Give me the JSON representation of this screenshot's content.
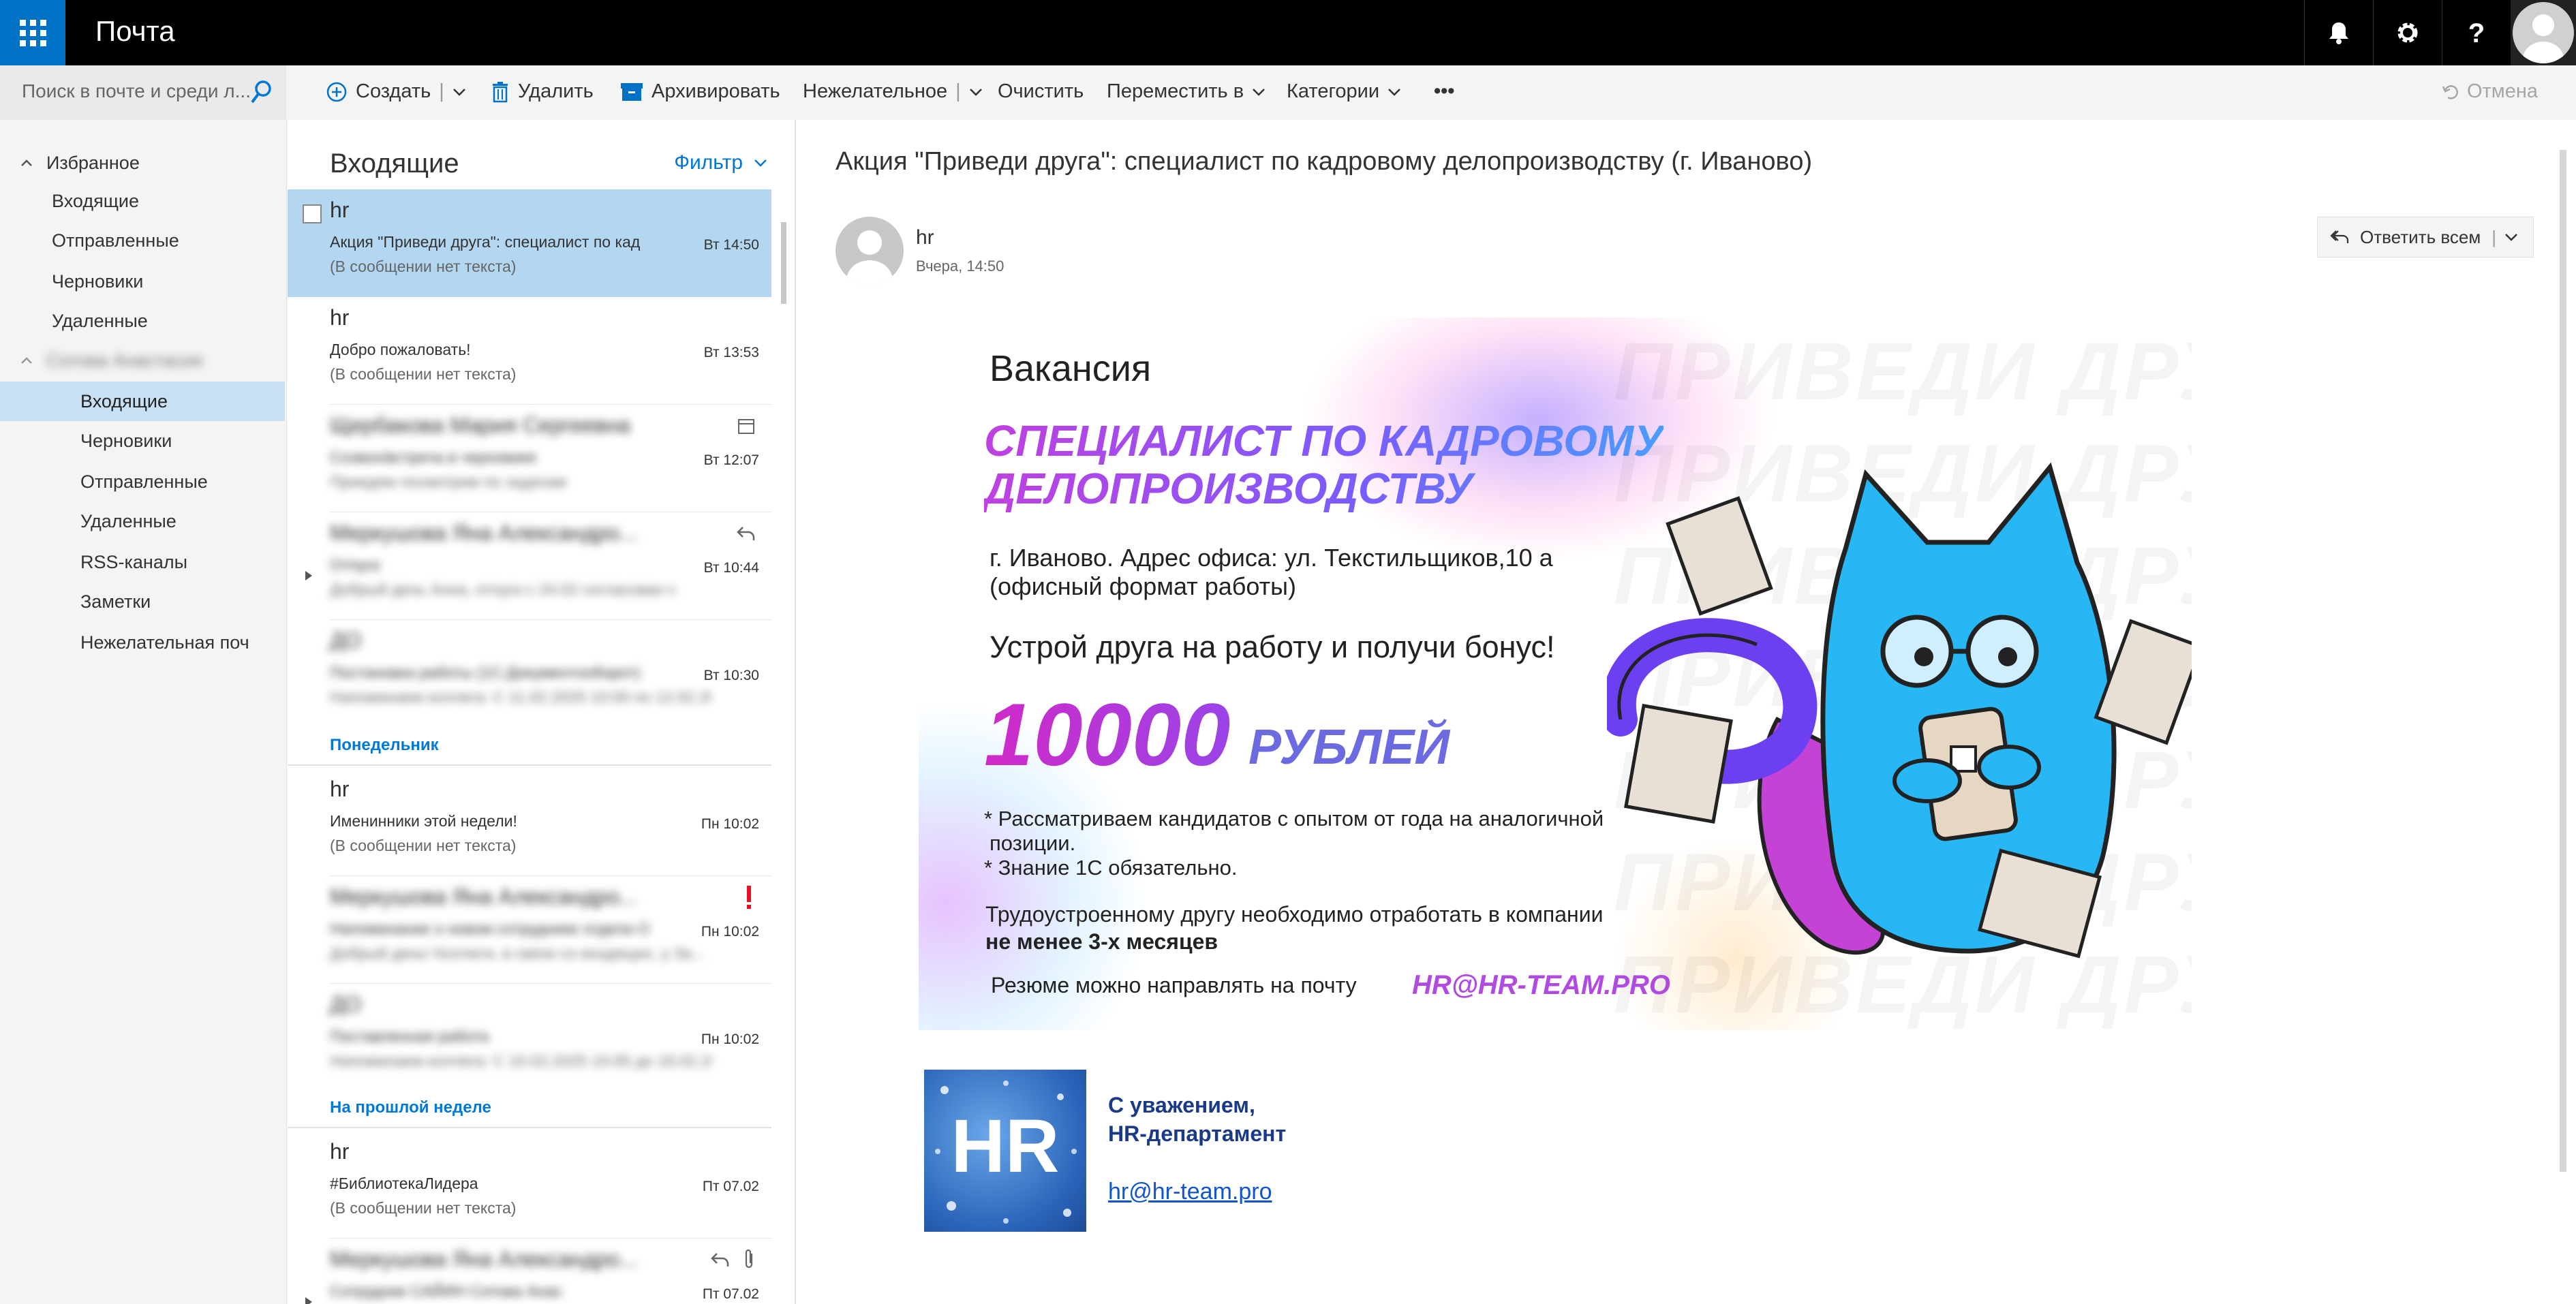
{
  "app": {
    "title": "Почта"
  },
  "search": {
    "placeholder": "Поиск в почте и среди л..."
  },
  "toolbar": {
    "create": "Создать",
    "delete": "Удалить",
    "archive": "Архивировать",
    "junk": "Нежелательное",
    "sweep": "Очистить",
    "move": "Переместить в",
    "categories": "Категории",
    "more": "•••",
    "undo": "Отмена"
  },
  "folders": {
    "favorites_header": "Избранное",
    "favorites": [
      "Входящие",
      "Отправленные",
      "Черновики",
      "Удаленные"
    ],
    "account_name": "Сотова Анастасия",
    "account_folders": [
      "Входящие",
      "Черновики",
      "Отправленные",
      "Удаленные",
      "RSS-каналы",
      "Заметки",
      "Нежелательная поч"
    ]
  },
  "message_list": {
    "title": "Входящие",
    "filter": "Фильтр",
    "groups": {
      "monday": "Понедельник",
      "last_week": "На прошлой неделе"
    },
    "messages": [
      {
        "sender": "hr",
        "subject": "Акция \"Приведи друга\": специалист по кад",
        "preview": "(В сообщении нет текста)",
        "time": "Вт 14:50"
      },
      {
        "sender": "hr",
        "subject": "Добро пожаловать!",
        "preview": "(В сообщении нет текста)",
        "time": "Вт 13:53"
      },
      {
        "sender": "Щербакова Мария Сергеевна",
        "subject": "Созвон/встреча в черновике",
        "preview": "Приедем посмотрим по задачам",
        "time": "Вт 12:07"
      },
      {
        "sender": "Меркушова Яна Александро...",
        "subject": "Отпуск",
        "preview": "Добрый день Анна, отпуск с 24.02 согласован с",
        "time": "Вт 10:44"
      },
      {
        "sender": "ДО",
        "subject": "Постановка работы (1С:Документооборот)",
        "preview": "Напоминаем коллега: С 11.02.2025 10:00 по 12.02.2025",
        "time": "Вт 10:30"
      },
      {
        "sender": "hr",
        "subject": "Именинники этой недели!",
        "preview": "(В сообщении нет текста)",
        "time": "Пн 10:02"
      },
      {
        "sender": "Меркушова Яна Александро...",
        "subject": "Напоминание о новом сотруднике отдела ОИКОВ",
        "preview": "Добрый день! Коллеги, в связи со входящих, у За...",
        "time": "Пн 10:02"
      },
      {
        "sender": "ДО",
        "subject": "Поставленная работа",
        "preview": "Напоминаем коллега: С 10.02.2025 10:05 до 18.02.20...",
        "time": "Пн 10:02"
      },
      {
        "sender": "hr",
        "subject": "#БиблиотекаЛидера",
        "preview": "(В сообщении нет текста)",
        "time": "Пт 07.02"
      },
      {
        "sender": "Меркушова Яна Александро...",
        "subject": "Сотрудник САЙИН Сотова Анас",
        "preview": "",
        "time": "Пт 07.02"
      }
    ]
  },
  "reading": {
    "subject": "Акция \"Приведи друга\": специалист по кадровому делопроизводству (г. Иваново)",
    "from": "hr",
    "date": "Вчера, 14:50",
    "reply_all": "Ответить всем"
  },
  "banner": {
    "watermark": "ПРИВЕДИ ДРУГА",
    "title": "Вакансия",
    "role_line1": "СПЕЦИАЛИСТ ПО КАДРОВОМУ",
    "role_line2": "ДЕЛОПРОИЗВОДСТВУ",
    "address_line1": "г. Иваново. Адрес офиса: ул. Текстильщиков,10 а",
    "address_line2": "(офисный формат работы)",
    "bonus": "Устрой друга на работу и получи бонус!",
    "amount": "10000",
    "currency": "РУБЛЕЙ",
    "req1_line1": "* Рассматриваем кандидатов с опытом от года на аналогичной",
    "req1_line2": "позиции.",
    "req2": "* Знание 1С обязательно.",
    "note_line1": "Трудоустроенному другу необходимо отработать в компании",
    "note_line2": "не менее 3-х месяцев",
    "resume": "Резюме можно направлять на почту",
    "email": "HR@HR-TEAM.PRO"
  },
  "signature": {
    "greeting": "С уважением,",
    "department": "HR-департамент",
    "email": "hr@hr-team.pro",
    "logo_text": "HR"
  },
  "colors": {
    "accent": "#0072c6",
    "selected": "#b3d7f0",
    "topbar": "#000000",
    "link": "#0078d7"
  }
}
